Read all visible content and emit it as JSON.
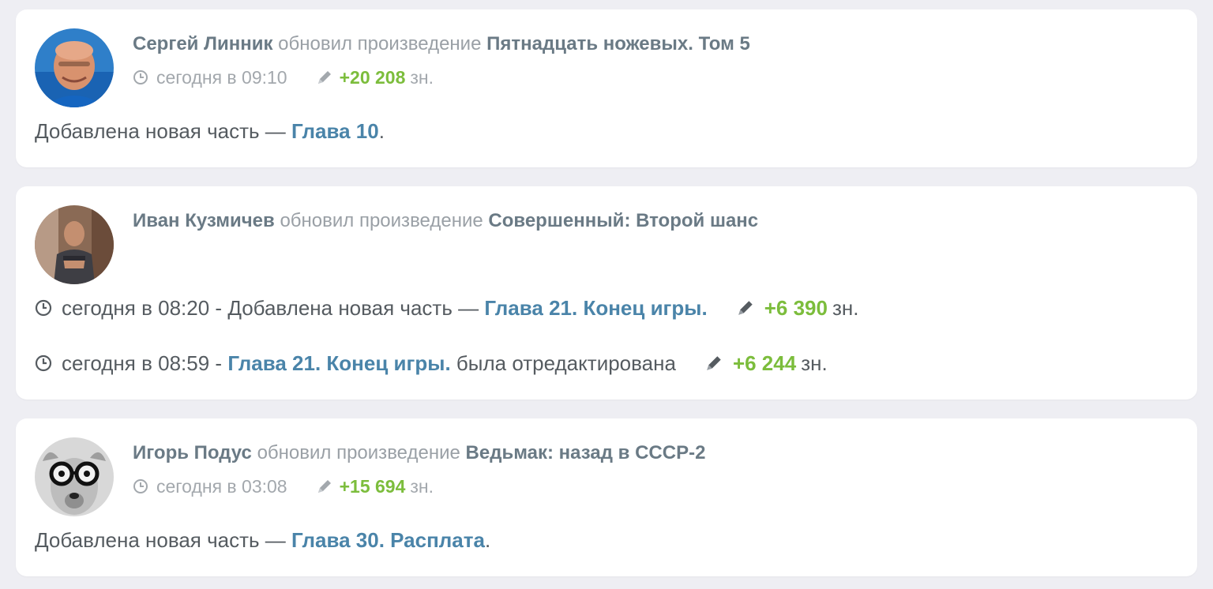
{
  "feed": [
    {
      "author": "Сергей Линник",
      "verb": "обновил произведение",
      "work": "Пятнадцать ножевых. Том 5",
      "time": "сегодня в 09:10",
      "chars": "+20 208",
      "unit": "зн.",
      "body_prefix": "Добавлена новая часть —",
      "chapter": "Глава 10",
      "body_suffix": "."
    },
    {
      "author": "Иван Кузмичев",
      "verb": "обновил произведение",
      "work": "Совершенный: Второй шанс",
      "rows": [
        {
          "time": "сегодня в 08:20 -",
          "text_before": "Добавлена новая часть —",
          "chapter": "Глава 21. Конец игры.",
          "text_after": "",
          "chars": "+6 390",
          "unit": "зн."
        },
        {
          "time": "сегодня в 08:59 -",
          "text_before": "",
          "chapter": "Глава 21. Конец игры.",
          "text_after": "была отредактирована",
          "chars": "+6 244",
          "unit": "зн."
        }
      ]
    },
    {
      "author": "Игорь Подус",
      "verb": "обновил произведение",
      "work": "Ведьмак: назад в СССР-2",
      "time": "сегодня в 03:08",
      "chars": "+15 694",
      "unit": "зн.",
      "body_prefix": "Добавлена новая часть —",
      "chapter": "Глава 30. Расплата",
      "body_suffix": "."
    }
  ],
  "icons": {
    "clock": "clock-icon",
    "pencil": "pencil-icon"
  },
  "colors": {
    "background": "#eeeef3",
    "card": "#ffffff",
    "author": "#6a7a85",
    "verb": "#9aa0a6",
    "meta": "#a3a8ad",
    "body": "#555b60",
    "link": "#4a84a9",
    "green": "#7cbd3c"
  }
}
